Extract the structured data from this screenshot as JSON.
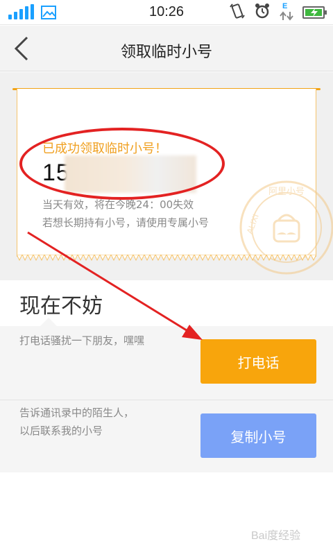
{
  "status_bar": {
    "time": "10:26",
    "network_type": "E",
    "icons": [
      "signal-icon",
      "gallery-icon",
      "rotation-lock-icon",
      "alarm-clock-icon",
      "data-arrows-icon",
      "battery-charging-icon"
    ]
  },
  "header": {
    "title": "领取临时小号",
    "back_icon": "chevron-left-icon"
  },
  "ticket": {
    "success_message": "已成功领取临时小号！",
    "phone_number": "15                 74",
    "validity_note": "当天有效，将在今晚24：00失效",
    "long_term_note": "若想长期持有小号，请使用专属小号",
    "stamp_text": "阿里小号 ALIXI",
    "colors": {
      "accent": "#f2a316",
      "success_text": "#f0a020"
    }
  },
  "actions": {
    "heading": "现在不妨",
    "call": {
      "description": "打电话骚扰一下朋友，嘿嘿",
      "button_label": "打电话",
      "color": "#f8a50c"
    },
    "copy": {
      "description_line1": "告诉通讯录中的陌生人，",
      "description_line2": "以后联系我的小号",
      "button_label": "复制小号",
      "color": "#7aa2f7"
    }
  },
  "watermark": "Bai度经验",
  "annotation_color": "#e32222"
}
